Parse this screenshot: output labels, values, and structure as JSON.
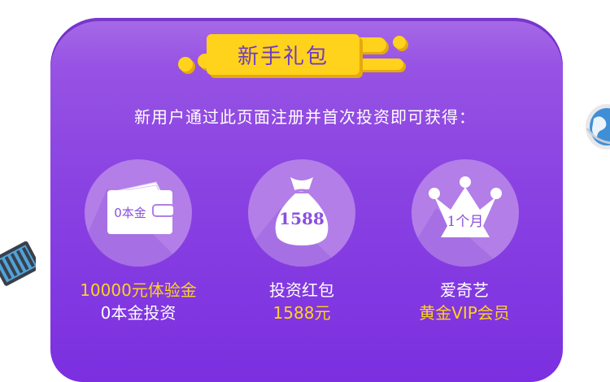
{
  "title": "新手礼包",
  "subtitle": "新用户通过此页面注册并首次投资即可获得：",
  "rewards": [
    {
      "icon_name": "wallet-icon",
      "icon_text": "0本金",
      "line1": "10000元体验金",
      "line2": "0本金投资"
    },
    {
      "icon_name": "money-bag-icon",
      "icon_text": "1588",
      "line1": "投资红包",
      "line2": "1588元"
    },
    {
      "icon_name": "crown-icon",
      "icon_text": "1个月",
      "line1": "爱奇艺",
      "line2": "黄金VIP会员"
    }
  ],
  "colors": {
    "card_top": "#9c59e4",
    "card_bottom": "#7b2fe0",
    "accent_yellow": "#ffd21c",
    "circle": "#b37ee8",
    "icon_fill": "#ffffff",
    "icon_text": "#8a4fe0"
  }
}
